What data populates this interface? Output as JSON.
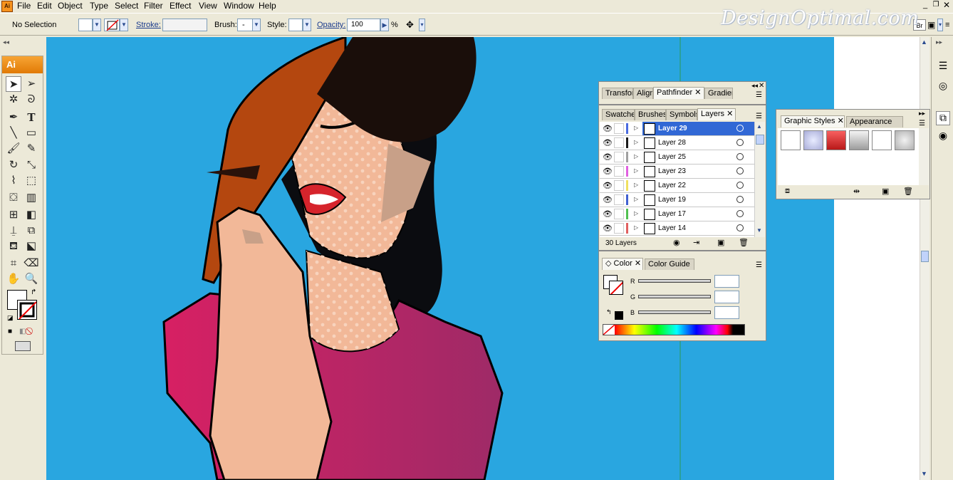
{
  "app": {
    "icon_label": "Ai"
  },
  "menu": [
    "File",
    "Edit",
    "Object",
    "Type",
    "Select",
    "Filter",
    "Effect",
    "View",
    "Window",
    "Help"
  ],
  "control_bar": {
    "selection": "No Selection",
    "stroke_label": "Stroke:",
    "brush_label": "Brush:",
    "brush_value": "-",
    "style_label": "Style:",
    "opacity_label": "Opacity:",
    "opacity_value": "100",
    "opacity_unit": "%"
  },
  "watermark": "DesignOptimal.com",
  "tools_panel": {
    "logo": "Ai"
  },
  "panel_transform": {
    "tabs": [
      "Transform",
      "Align",
      "Pathfinder",
      "Gradient"
    ],
    "active": "Pathfinder"
  },
  "panel_layers": {
    "tabs": [
      "Swatches",
      "Brushes",
      "Symbols",
      "Layers"
    ],
    "active": "Layers",
    "rows": [
      {
        "name": "Layer 29",
        "color": "#4a6be0",
        "selected": true
      },
      {
        "name": "Layer 28",
        "color": "#1a1a1a",
        "selected": false
      },
      {
        "name": "Layer 25",
        "color": "#a0a0a0",
        "selected": false
      },
      {
        "name": "Layer 23",
        "color": "#e060e0",
        "selected": false
      },
      {
        "name": "Layer 22",
        "color": "#f0e060",
        "selected": false
      },
      {
        "name": "Layer 19",
        "color": "#4060d0",
        "selected": false
      },
      {
        "name": "Layer 17",
        "color": "#50c050",
        "selected": false
      },
      {
        "name": "Layer 14",
        "color": "#e06060",
        "selected": false
      }
    ],
    "count": "30 Layers"
  },
  "panel_color": {
    "tabs": [
      "Color",
      "Color Guide"
    ],
    "active": "Color",
    "channels": [
      "R",
      "G",
      "B"
    ]
  },
  "panel_graphic_styles": {
    "tabs": [
      "Graphic Styles",
      "Appearance"
    ],
    "active": "Graphic Styles"
  },
  "colors": {
    "canvas": "#29a6e0",
    "selection": "#3168d5",
    "shirt": "#d42466",
    "skin": "#f2b898",
    "hat": "#b4470f",
    "hair": "#0b0c10"
  }
}
